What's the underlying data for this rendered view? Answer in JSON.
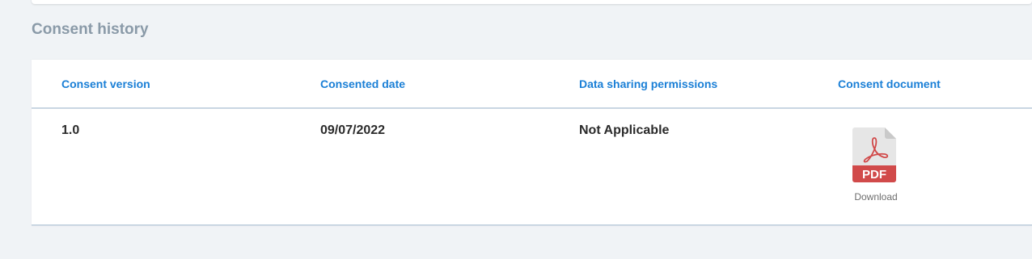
{
  "section_title": "Consent history",
  "table": {
    "columns": [
      "Consent version",
      "Consented date",
      "Data sharing permissions",
      "Consent document"
    ],
    "rows": [
      {
        "version": "1.0",
        "date": "09/07/2022",
        "permissions": "Not Applicable",
        "document": {
          "icon": "pdf-file-icon",
          "badge": "PDF",
          "link_label": "Download"
        }
      }
    ]
  },
  "colors": {
    "header_text": "#1a7fd6",
    "section_title": "#8a9aa8",
    "pdf_red": "#d14a4a",
    "background": "#f0f3f6"
  }
}
